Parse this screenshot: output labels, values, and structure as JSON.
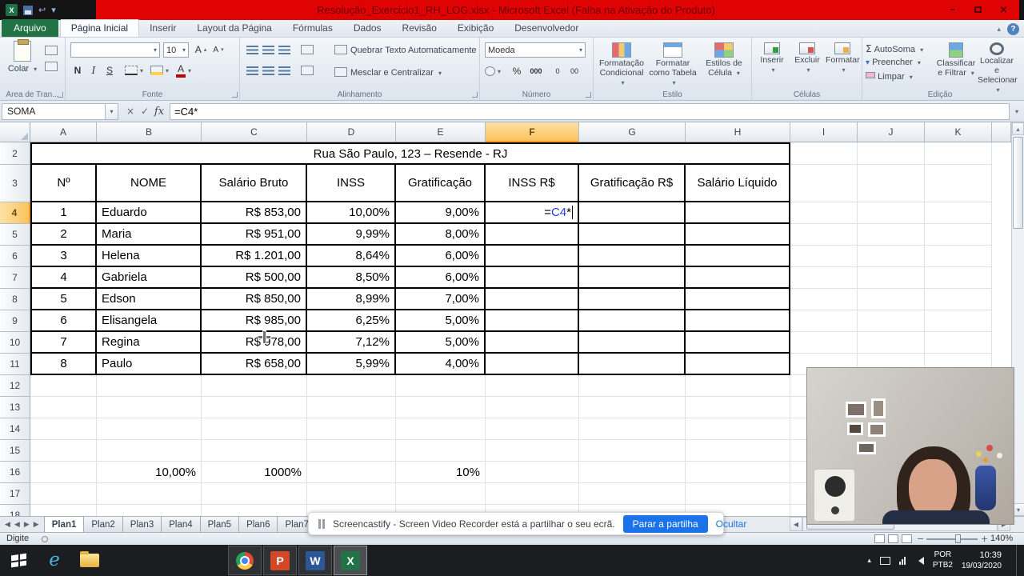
{
  "titlebar": {
    "title": "Resolução_Exercicio1_RH_LOG.xlsx  -  Microsoft Excel (Falha na Ativação do Produto)"
  },
  "icons": {
    "dropdown": "▾",
    "up": "▴",
    "down": "▾",
    "prev": "◀",
    "next": "▶",
    "cancel": "×",
    "check": "✓",
    "fx": "fx",
    "sigma": "Σ",
    "help": "?",
    "minimize": "–",
    "close": "×",
    "undo": "↩",
    "zoom_out": "−",
    "zoom_in": "+",
    "percent": "%",
    "thousands": "000",
    "zero": "0",
    "double_zero": "00",
    "collapse": "▴",
    "expand": "▾"
  },
  "ribbon": {
    "tabs": [
      "Arquivo",
      "Página Inicial",
      "Inserir",
      "Layout da Página",
      "Fórmulas",
      "Dados",
      "Revisão",
      "Exibição",
      "Desenvolvedor"
    ],
    "active_tab": "Página Inicial",
    "clipboard": {
      "paste": "Colar",
      "label": "Área de Tran..."
    },
    "font": {
      "label": "Fonte",
      "size": "10",
      "bold": "N",
      "italic": "I",
      "underline": "S",
      "grow": "A",
      "shrink": "A"
    },
    "alignment": {
      "label": "Alinhamento",
      "wrap": "Quebrar Texto Automaticamente",
      "merge": "Mesclar e Centralizar"
    },
    "number": {
      "label": "Número",
      "format": "Moeda"
    },
    "style": {
      "label": "Estilo",
      "b1": [
        "Formatação",
        "Condicional"
      ],
      "b2": [
        "Formatar",
        "como Tabela"
      ],
      "b3": [
        "Estilos de",
        "Célula"
      ]
    },
    "cells": {
      "label": "Células",
      "insert": "Inserir",
      "delete": "Excluir",
      "format": "Formatar"
    },
    "editing": {
      "label": "Edição",
      "autosum": "AutoSoma",
      "fill": "Preencher",
      "clear": "Limpar",
      "sort": [
        "Classificar",
        "e Filtrar"
      ],
      "find": [
        "Localizar e",
        "Selecionar"
      ]
    }
  },
  "formula_bar": {
    "name_box": "SOMA",
    "formula": "=C4*"
  },
  "sheet": {
    "columns": [
      "A",
      "B",
      "C",
      "D",
      "E",
      "F",
      "G",
      "H",
      "I",
      "J",
      "K"
    ],
    "selected_column": "F",
    "selected_row": 4,
    "title_row": {
      "row": 2,
      "text": "Rua São Paulo, 123 – Resende - RJ"
    },
    "header_row": {
      "row": 3,
      "cells": {
        "A": "Nº",
        "B": "NOME",
        "C": "Salário Bruto",
        "D": "INSS",
        "E": "Gratificação",
        "F": "INSS R$",
        "G": "Gratificação R$",
        "H": "Salário Líquido"
      }
    },
    "data_rows": [
      {
        "row": 4,
        "n": "1",
        "nome": "Eduardo",
        "salario": "R$ 853,00",
        "inss": "10,00%",
        "grat": "9,00%"
      },
      {
        "row": 5,
        "n": "2",
        "nome": "Maria",
        "salario": "R$ 951,00",
        "inss": "9,99%",
        "grat": "8,00%"
      },
      {
        "row": 6,
        "n": "3",
        "nome": "Helena",
        "salario": "R$ 1.201,00",
        "inss": "8,64%",
        "grat": "6,00%"
      },
      {
        "row": 7,
        "n": "4",
        "nome": "Gabriela",
        "salario": "R$ 500,00",
        "inss": "8,50%",
        "grat": "6,00%"
      },
      {
        "row": 8,
        "n": "5",
        "nome": "Edson",
        "salario": "R$ 850,00",
        "inss": "8,99%",
        "grat": "7,00%"
      },
      {
        "row": 9,
        "n": "6",
        "nome": "Elisangela",
        "salario": "R$ 985,00",
        "inss": "6,25%",
        "grat": "5,00%"
      },
      {
        "row": 10,
        "n": "7",
        "nome": "Regina",
        "salario": "R$ 978,00",
        "inss": "7,12%",
        "grat": "5,00%"
      },
      {
        "row": 11,
        "n": "8",
        "nome": "Paulo",
        "salario": "R$ 658,00",
        "inss": "5,99%",
        "grat": "4,00%"
      }
    ],
    "extra_cells": [
      {
        "ref": "B16",
        "text": "10,00%"
      },
      {
        "ref": "C16",
        "text": "1000%"
      },
      {
        "ref": "E16",
        "text": "10%"
      }
    ],
    "active_cell": {
      "address": "F4",
      "parts": [
        "=",
        "C4",
        "*"
      ],
      "referenced_cell": "C4"
    }
  },
  "sheet_tabs": [
    "Plan1",
    "Plan2",
    "Plan3",
    "Plan4",
    "Plan5",
    "Plan6",
    "Plan7"
  ],
  "status_bar": {
    "mode": "Digite",
    "zoom": "140%"
  },
  "screencastify": {
    "text": "Screencastify - Screen Video Recorder está a partilhar o seu ecrã.",
    "stop": "Parar a partilha",
    "hide": "Ocultar"
  },
  "taskbar": {
    "apps": [
      {
        "id": "internet-explorer",
        "glyph": "e"
      },
      {
        "id": "file-explorer"
      },
      {
        "id": "chrome",
        "open": true
      },
      {
        "id": "powerpoint",
        "glyph": "P",
        "open": true
      },
      {
        "id": "word",
        "glyph": "W",
        "open": true
      },
      {
        "id": "excel",
        "glyph": "X",
        "open": true,
        "active": true
      }
    ],
    "tray": {
      "lang_top": "POR",
      "lang_bottom": "PTB2",
      "time": "10:39",
      "date": "19/03/2020"
    }
  }
}
